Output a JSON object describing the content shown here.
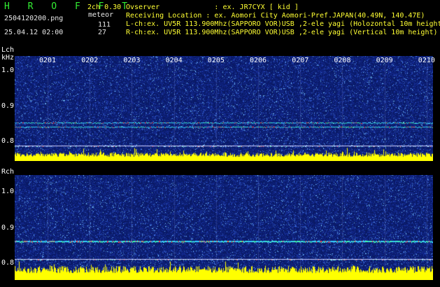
{
  "header": {
    "logo": "H R O F F T",
    "version": "2ch 0.30",
    "filename": "2504120200.png",
    "mode": "meteor",
    "datetime": "25.04.12 02:00",
    "lch_count": "111",
    "rch_count": "27",
    "info_lines": [
      "Ovserver             : ex. JR7CYX [ kid ]",
      "Receiving Location : ex. Aomori City Aomori-Pref.JAPAN(40.49N, 140.47E)",
      "L-ch:ex. UV5R 113.900Mhz(SAPPORO VOR)USB ,2-ele yagi (Holozontal 10m height)",
      "R-ch:ex. UV5R 113.900Mhz(SAPPORO VOR)USB ,2-ele yagi (Vertical 10m height)"
    ]
  },
  "lch": {
    "label": "Lch",
    "unit": "kHz",
    "y_ticks": [
      "1.0",
      "0.9",
      "0.8"
    ]
  },
  "rch": {
    "label": "Rch",
    "y_ticks": [
      "1.0",
      "0.9",
      "0.8"
    ]
  },
  "time_ticks": [
    "0201",
    "0202",
    "0203",
    "0204",
    "0205",
    "0206",
    "0207",
    "0208",
    "0209",
    "0210"
  ],
  "colors": {
    "text_green": "#33ee33",
    "text_yellow": "#ffff33",
    "background": "#000000",
    "spectrum_bg": "#0a1a66",
    "noise_bar": "#ffff00"
  }
}
